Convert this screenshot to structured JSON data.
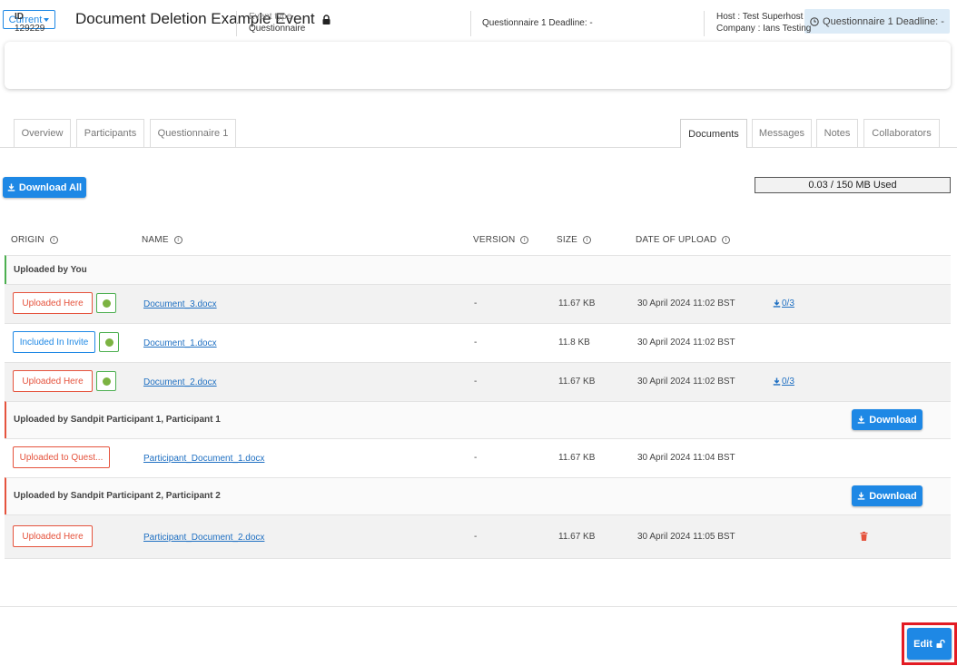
{
  "header": {
    "current_label": "Current",
    "title": "Document Deletion Example Event",
    "deadline_chip": "Questionnaire 1 Deadline: -"
  },
  "info": {
    "id_label": "ID",
    "id_value": "129229",
    "event_type_label": "Event type",
    "event_type_value": "Questionnaire",
    "deadline": "Questionnaire 1 Deadline: -",
    "host": "Host : Test Superhost",
    "company": "Company : Ians Testing"
  },
  "tabs_left": [
    "Overview",
    "Participants",
    "Questionnaire 1"
  ],
  "tabs_right": [
    "Documents",
    "Messages",
    "Notes",
    "Collaborators"
  ],
  "active_tab": "Documents",
  "toolbar": {
    "download_all": "Download All",
    "storage": "0.03 / 150 MB Used"
  },
  "table": {
    "columns": [
      "ORIGIN",
      "NAME",
      "VERSION",
      "SIZE",
      "DATE OF UPLOAD"
    ],
    "groups": [
      {
        "label": "Uploaded by You",
        "rows": [
          {
            "origin": "Uploaded Here",
            "name": "Document_3.docx",
            "version": "-",
            "size": "11.67 KB",
            "date": "30 April 2024 11:02 BST",
            "downloads": "0/3"
          },
          {
            "origin": "Included In Invite",
            "name": "Document_1.docx",
            "version": "-",
            "size": "11.8 KB",
            "date": "30 April 2024 11:02 BST",
            "downloads": ""
          },
          {
            "origin": "Uploaded Here",
            "name": "Document_2.docx",
            "version": "-",
            "size": "11.67 KB",
            "date": "30 April 2024 11:02 BST",
            "downloads": "0/3"
          }
        ]
      },
      {
        "label": "Uploaded by Sandpit Participant 1, Participant 1",
        "download_label": "Download",
        "rows": [
          {
            "origin": "Uploaded to Quest...",
            "name": "Participant_Document_1.docx",
            "version": "-",
            "size": "11.67 KB",
            "date": "30 April 2024 11:04 BST"
          }
        ]
      },
      {
        "label": "Uploaded by Sandpit Participant 2, Participant 2",
        "download_label": "Download",
        "rows": [
          {
            "origin": "Uploaded Here",
            "name": "Participant_Document_2.docx",
            "version": "-",
            "size": "11.67 KB",
            "date": "30 April 2024 11:05 BST"
          }
        ]
      }
    ]
  },
  "footer": {
    "edit_label": "Edit"
  },
  "colors": {
    "accent": "#1e88e5",
    "danger": "#e5533d",
    "success": "#4caf50",
    "highlight": "#e31b23"
  }
}
